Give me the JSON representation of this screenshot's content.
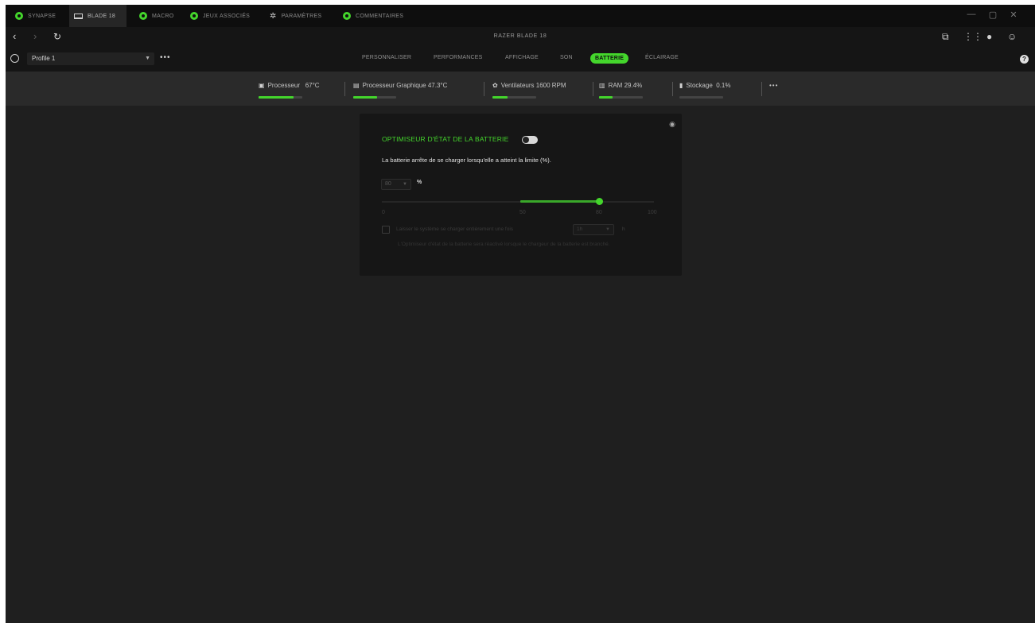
{
  "tabs": [
    {
      "label": "SYNAPSE",
      "icon": "razer-logo-icon"
    },
    {
      "label": "BLADE 18",
      "icon": "laptop-icon"
    },
    {
      "label": "MACRO",
      "icon": "macro-icon"
    },
    {
      "label": "JEUX ASSOCIÉS",
      "icon": "gamepad-icon"
    },
    {
      "label": "PARAMÈTRES",
      "icon": "gear-icon"
    },
    {
      "label": "COMMENTAIRES",
      "icon": "feedback-icon"
    }
  ],
  "device": {
    "title": "RAZER BLADE 18"
  },
  "profile": {
    "name": "Profile 1"
  },
  "subtabs": [
    {
      "label": "PERSONNALISER"
    },
    {
      "label": "PERFORMANCES"
    },
    {
      "label": "AFFICHAGE"
    },
    {
      "label": "SON"
    },
    {
      "label": "BATTERIE"
    },
    {
      "label": "ÉCLAIRAGE"
    }
  ],
  "status": {
    "cpu_label": "Processeur",
    "cpu_value": "67°C",
    "cpu_level": 0.8,
    "gpu_label": "Processeur Graphique",
    "gpu_value": "47.3°C",
    "gpu_level": 0.55,
    "fan_label": "Ventilateurs",
    "fan_value": "1600 RPM",
    "fan_level": 0.35,
    "ram_label": "RAM",
    "ram_value": "29.4%",
    "ram_level": 0.3,
    "storage_label": "Stockage",
    "storage_value": "0.1%",
    "storage_level": 0.0
  },
  "battery": {
    "title": "OPTIMISEUR D'ÉTAT DE LA BATTERIE",
    "description": "La batterie arrête de se charger lorsqu'elle a atteint la limite (%).",
    "limit_value": "80",
    "limit_unit": "%",
    "slider_value": 80,
    "ticks": [
      "0",
      "50",
      "80",
      "100"
    ],
    "keep_label": "Laisser le système se charger entièrement une fois",
    "keep_value": "1h",
    "keep_unit": "h",
    "keep_note": "L'Optimiseur d'état de la batterie sera réactivé lorsque le chargeur de la batterie est branché."
  },
  "colors": {
    "accent": "#44d62c",
    "background": "#1f1f1f",
    "card": "#161616",
    "topbar": "#0e0e0e"
  }
}
